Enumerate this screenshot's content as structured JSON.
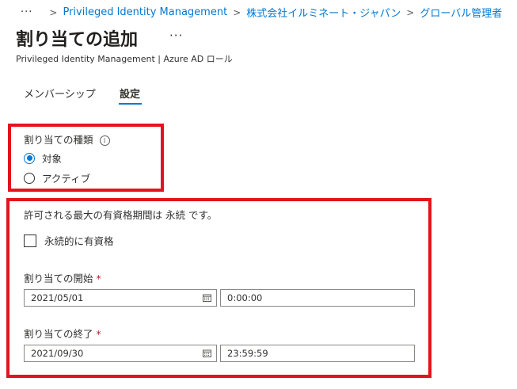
{
  "breadcrumb": {
    "ellipsis": "···",
    "items": [
      "Privileged Identity Management",
      "株式会社イルミネート・ジャパン",
      "グローバル管理者"
    ]
  },
  "header": {
    "title": "割り当ての追加",
    "more": "···",
    "subtitle": "Privileged Identity Management | Azure AD ロール"
  },
  "tabs": [
    {
      "label": "メンバーシップ",
      "active": false
    },
    {
      "label": "設定",
      "active": true
    }
  ],
  "assignment_type": {
    "label": "割り当ての種類",
    "info_icon": "info-icon",
    "options": [
      {
        "label": "対象",
        "checked": true
      },
      {
        "label": "アクティブ",
        "checked": false
      }
    ]
  },
  "duration": {
    "message": "許可される最大の有資格期間は 永続 です。",
    "permanent_checkbox": {
      "label": "永続的に有資格",
      "checked": false
    },
    "start": {
      "label": "割り当ての開始",
      "required": "*",
      "date": "2021/05/01",
      "time": "0:00:00"
    },
    "end": {
      "label": "割り当ての終了",
      "required": "*",
      "date": "2021/09/30",
      "time": "23:59:59"
    }
  },
  "colors": {
    "accent": "#0078d4",
    "highlight_box": "#e3141e",
    "required": "#a4262c"
  }
}
